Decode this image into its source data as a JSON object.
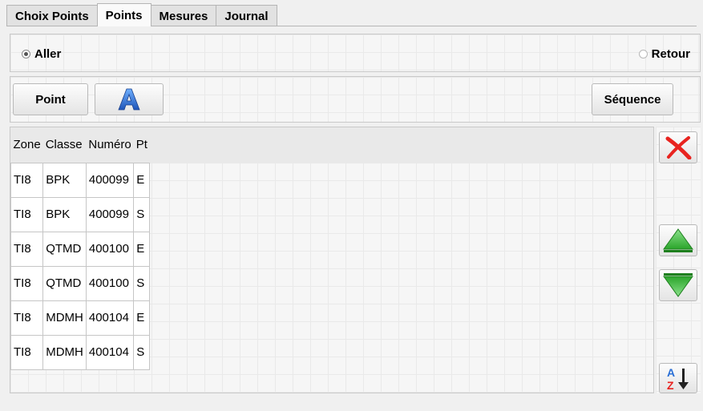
{
  "tabs": [
    {
      "label": "Choix Points",
      "active": false
    },
    {
      "label": "Points",
      "active": true
    },
    {
      "label": "Mesures",
      "active": false
    },
    {
      "label": "Journal",
      "active": false
    }
  ],
  "direction": {
    "aller_label": "Aller",
    "retour_label": "Retour",
    "selected": "Aller"
  },
  "toolbar": {
    "point_label": "Point",
    "font_icon": "font-a-icon",
    "sequence_label": "Séquence"
  },
  "table": {
    "columns": [
      "Zone",
      "Classe",
      "Numéro",
      "Pt"
    ],
    "rows": [
      [
        "TI8",
        "BPK",
        "400099",
        "E"
      ],
      [
        "TI8",
        "BPK",
        "400099",
        "S"
      ],
      [
        "TI8",
        "QTMD",
        "400100",
        "E"
      ],
      [
        "TI8",
        "QTMD",
        "400100",
        "S"
      ],
      [
        "TI8",
        "MDMH",
        "400104",
        "E"
      ],
      [
        "TI8",
        "MDMH",
        "400104",
        "S"
      ]
    ]
  },
  "side_icons": {
    "delete": "delete-x-icon",
    "up": "arrow-up-icon",
    "down": "arrow-down-icon",
    "sort": "sort-az-icon"
  },
  "colors": {
    "delete_red": "#e8231f",
    "arrow_green": "#3cb83c",
    "font_icon_blue": "#2a6fd6"
  }
}
